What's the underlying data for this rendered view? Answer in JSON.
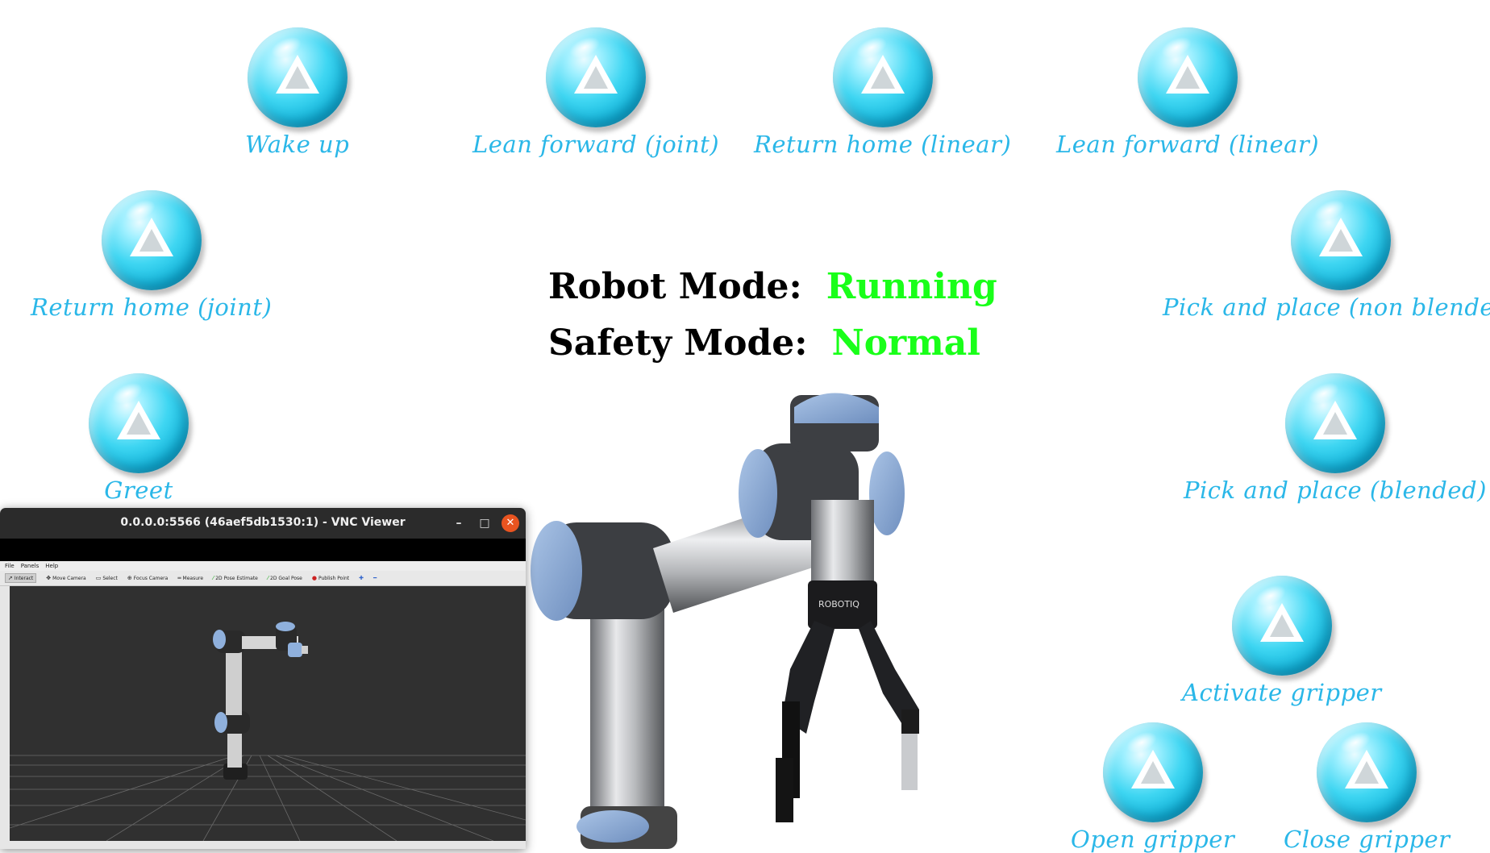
{
  "actions": [
    {
      "label": "Wake up"
    },
    {
      "label": "Lean forward (joint)"
    },
    {
      "label": "Return home (linear)"
    },
    {
      "label": "Lean forward (linear)"
    },
    {
      "label": "Return home (joint)"
    },
    {
      "label": "Pick and place (non blended)"
    },
    {
      "label": "Greet"
    },
    {
      "label": "Pick and place (blended)"
    },
    {
      "label": "Activate gripper"
    },
    {
      "label": "Open gripper"
    },
    {
      "label": "Close gripper"
    }
  ],
  "status": {
    "robot_mode_label": "Robot Mode:",
    "robot_mode_value": "Running",
    "safety_mode_label": "Safety Mode:",
    "safety_mode_value": "Normal",
    "ok_color": "#19ff19"
  },
  "gripper_brand": "ROBOTIQ",
  "vnc": {
    "title": "0.0.0.0:5566 (46aef5db1530:1) - VNC Viewer",
    "minimize": "–",
    "maximize": "□",
    "close": "✕",
    "menu": [
      "File",
      "Panels",
      "Help"
    ],
    "tools": [
      "Interact",
      "Move Camera",
      "Select",
      "Focus Camera",
      "Measure",
      "2D Pose Estimate",
      "2D Goal Pose",
      "Publish Point"
    ]
  },
  "colors": {
    "label": "#2ab7e8",
    "bubble": "#12b5db",
    "ubuntu_close": "#e95420"
  }
}
